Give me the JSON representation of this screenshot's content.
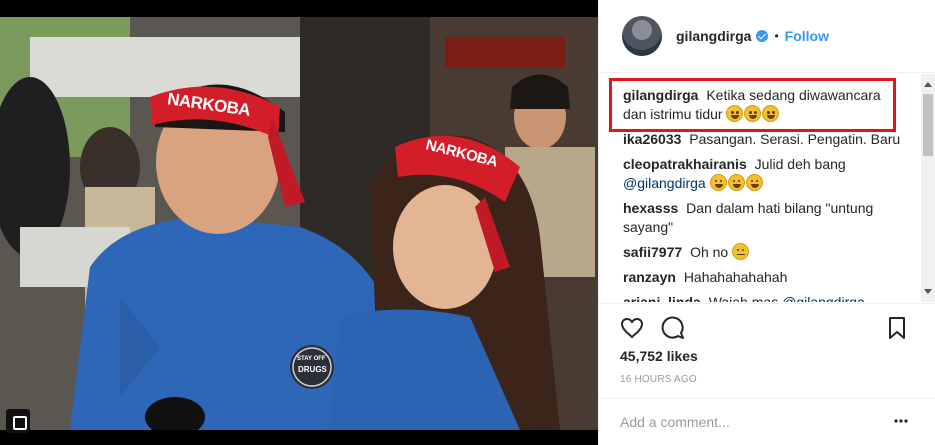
{
  "post": {
    "username": "gilangdirga",
    "follow_label": "Follow",
    "dot": "•"
  },
  "comments": [
    {
      "user": "gilangdirga",
      "text": "Ketika sedang diwawancara dan istrimu tidur",
      "emojis": 3
    },
    {
      "user": "ika26033",
      "text": "Pasangan. Serasi. Pengatin. Baru"
    },
    {
      "user": "cleopatrakhairanis",
      "text": "Julid deh bang",
      "mention": "@gilangdirga",
      "emojis": 3
    },
    {
      "user": "hexasss",
      "text": "Dan dalam hati bilang \"untung sayang\""
    },
    {
      "user": "safii7977",
      "text": "Oh no",
      "emojis": 1
    },
    {
      "user": "ranzayn",
      "text": "Hahahahahahah"
    },
    {
      "user": "ariani_linda",
      "text": "Wajah mas",
      "mention": "@gilangdirga"
    }
  ],
  "stats": {
    "likes": "45,752 likes",
    "time_ago": "16 HOURS AGO"
  },
  "add_comment": {
    "placeholder": "Add a comment..."
  },
  "photo": {
    "headband_text_1": "NARKOBA",
    "headband_text_2": "NARKOBA",
    "badge_text_1": "STAY OFF",
    "badge_text_2": "DRUGS"
  },
  "colors": {
    "accent": "#3897f0",
    "highlight_border": "#e0161b",
    "headband": "#d31e2a"
  },
  "icons": [
    "verified-badge-icon",
    "heart-icon",
    "comment-icon",
    "bookmark-icon",
    "more-options-icon",
    "emoji-laughing-icon"
  ]
}
